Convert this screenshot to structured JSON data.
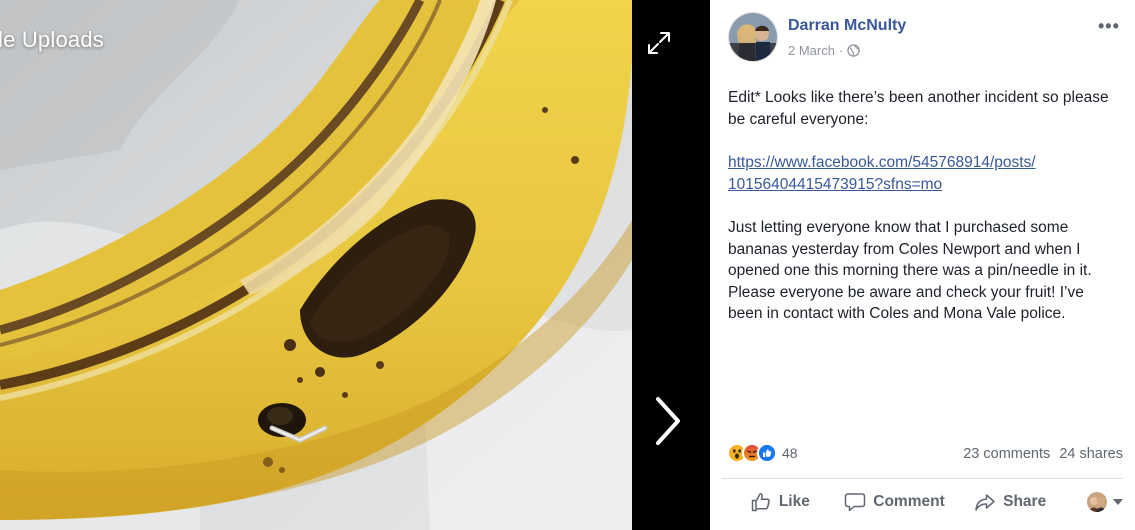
{
  "viewer": {
    "album_title": "le Uploads",
    "icons": {
      "expand": "expand-arrows-icon",
      "next": "chevron-right-icon"
    }
  },
  "post": {
    "author": "Darran McNulty",
    "date": "2 March",
    "separator": "·",
    "privacy_icon": "globe-icon",
    "more_label": "•••",
    "edit_note": "Edit* Looks like there’s been another incident so please be careful everyone:",
    "link_line1": "https://www.facebook.com/545768914/posts/",
    "link_line2": "10156404415473915?sfns=mo",
    "body": "Just letting everyone know that I purchased some bananas yesterday from Coles Newport and when I opened one this morning there was a pin/needle in it. Please everyone be aware and check your fruit! I’ve been in contact with Coles and Mona Vale police."
  },
  "engagement": {
    "reaction_icons": [
      "wow-reaction-icon",
      "angry-reaction-icon",
      "like-reaction-icon"
    ],
    "reaction_count": "48",
    "comments": "23 comments",
    "shares": "24 shares"
  },
  "actions": {
    "like": "Like",
    "comment": "Comment",
    "share": "Share"
  },
  "colors": {
    "link": "#385898",
    "text": "#1d2129",
    "muted": "#606770",
    "like_blue": "#1877f2",
    "angry": "#e9710f",
    "wow": "#f7b125"
  }
}
